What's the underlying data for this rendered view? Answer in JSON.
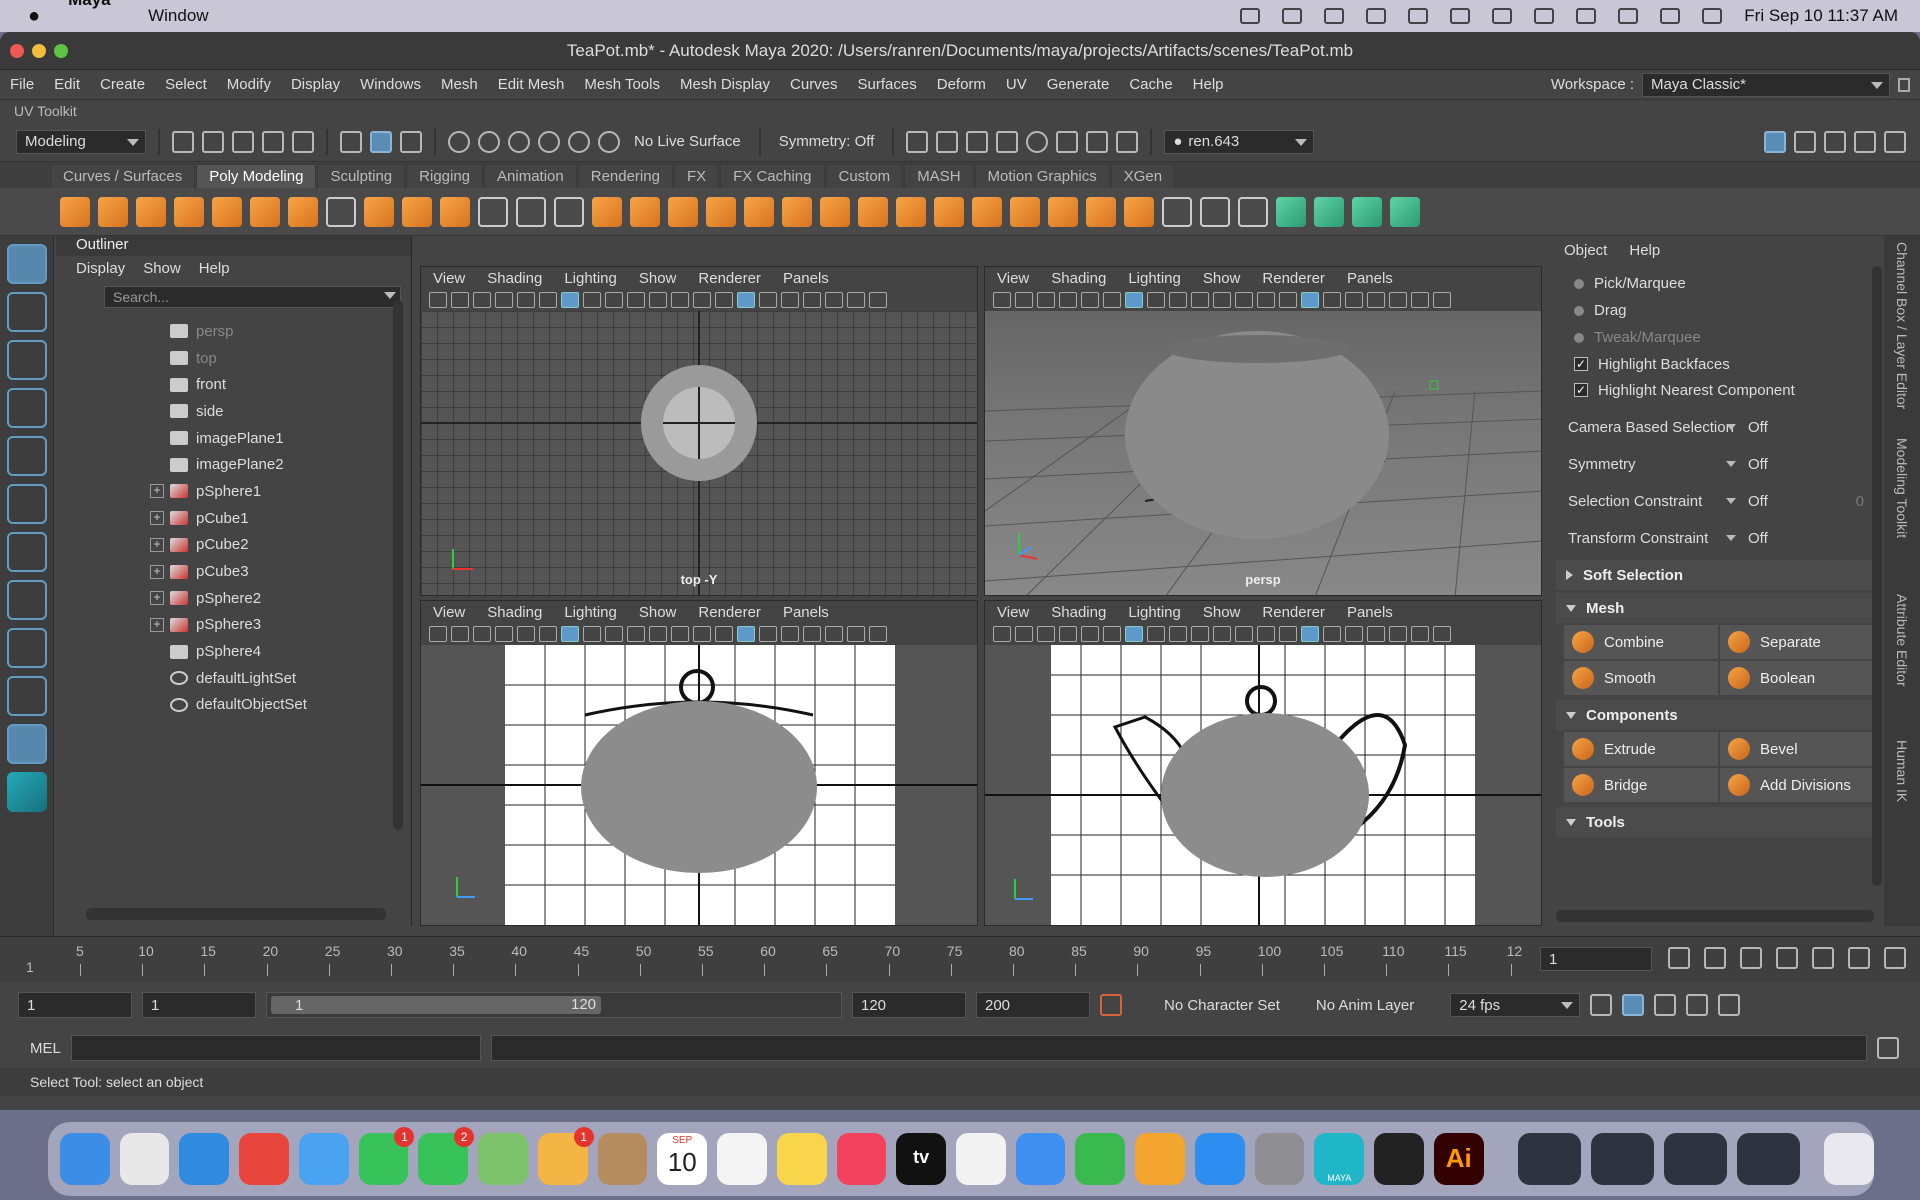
{
  "macos": {
    "app_name": "Maya",
    "menus": [
      "Window"
    ],
    "clock": "Fri Sep 10  11:37 AM"
  },
  "window": {
    "title": "TeaPot.mb* - Autodesk Maya 2020: /Users/ranren/Documents/maya/projects/Artifacts/scenes/TeaPot.mb"
  },
  "menubar": {
    "items": [
      "File",
      "Edit",
      "Create",
      "Select",
      "Modify",
      "Display",
      "Windows",
      "Mesh",
      "Edit Mesh",
      "Mesh Tools",
      "Mesh Display",
      "Curves",
      "Surfaces",
      "Deform",
      "UV",
      "Generate",
      "Cache",
      "Help"
    ],
    "workspace_label": "Workspace :",
    "workspace_value": "Maya Classic*"
  },
  "uv_toolkit": "UV Toolkit",
  "statusline": {
    "mode": "Modeling",
    "live_surface": "No Live Surface",
    "symmetry": "Symmetry: Off",
    "user": "ren.643"
  },
  "shelf": {
    "tabs": [
      "Curves / Surfaces",
      "Poly Modeling",
      "Sculpting",
      "Rigging",
      "Animation",
      "Rendering",
      "FX",
      "FX Caching",
      "Custom",
      "MASH",
      "Motion Graphics",
      "XGen"
    ],
    "active_tab": "Poly Modeling"
  },
  "outliner": {
    "title": "Outliner",
    "menus": [
      "Display",
      "Show",
      "Help"
    ],
    "search_placeholder": "Search...",
    "items": [
      {
        "name": "persp",
        "kind": "camera",
        "dim": true,
        "expand": false
      },
      {
        "name": "top",
        "kind": "camera",
        "dim": true,
        "expand": false
      },
      {
        "name": "front",
        "kind": "camera",
        "dim": false,
        "expand": false
      },
      {
        "name": "side",
        "kind": "camera",
        "dim": false,
        "expand": false
      },
      {
        "name": "imagePlane1",
        "kind": "image",
        "dim": false,
        "expand": false
      },
      {
        "name": "imagePlane2",
        "kind": "image",
        "dim": false,
        "expand": false
      },
      {
        "name": "pSphere1",
        "kind": "mesh",
        "dim": false,
        "expand": true
      },
      {
        "name": "pCube1",
        "kind": "mesh",
        "dim": false,
        "expand": true
      },
      {
        "name": "pCube2",
        "kind": "mesh",
        "dim": false,
        "expand": true
      },
      {
        "name": "pCube3",
        "kind": "mesh",
        "dim": false,
        "expand": true
      },
      {
        "name": "pSphere2",
        "kind": "mesh",
        "dim": false,
        "expand": true
      },
      {
        "name": "pSphere3",
        "kind": "mesh",
        "dim": false,
        "expand": true
      },
      {
        "name": "pSphere4",
        "kind": "group",
        "dim": false,
        "expand": false
      },
      {
        "name": "defaultLightSet",
        "kind": "set",
        "dim": false,
        "expand": false
      },
      {
        "name": "defaultObjectSet",
        "kind": "set",
        "dim": false,
        "expand": false
      }
    ]
  },
  "viewports": {
    "menus": [
      "View",
      "Shading",
      "Lighting",
      "Show",
      "Renderer",
      "Panels"
    ],
    "top_label": "top -Y",
    "persp_label": "persp"
  },
  "toolkit": {
    "menus": [
      "Object",
      "Help"
    ],
    "radios": [
      {
        "label": "Pick/Marquee",
        "dim": false
      },
      {
        "label": "Drag",
        "dim": false
      },
      {
        "label": "Tweak/Marquee",
        "dim": true
      }
    ],
    "checks": [
      "Highlight Backfaces",
      "Highlight Nearest Component"
    ],
    "options": [
      {
        "label": "Camera Based Selection",
        "value": "Off"
      },
      {
        "label": "Symmetry",
        "value": "Off"
      },
      {
        "label": "Selection Constraint",
        "value": "Off",
        "extra": "0"
      },
      {
        "label": "Transform Constraint",
        "value": "Off"
      }
    ],
    "soft_selection": "Soft Selection",
    "mesh_section": "Mesh",
    "mesh_buttons": [
      "Combine",
      "Separate",
      "Smooth",
      "Boolean"
    ],
    "components_section": "Components",
    "components_buttons": [
      "Extrude",
      "Bevel",
      "Bridge",
      "Add Divisions"
    ],
    "tools_section": "Tools"
  },
  "side_tabs": [
    "Channel Box / Layer Editor",
    "Modeling Toolkit",
    "Attribute Editor",
    "Human IK"
  ],
  "timeline": {
    "ticks": [
      "5",
      "10",
      "15",
      "20",
      "25",
      "30",
      "35",
      "40",
      "45",
      "50",
      "55",
      "60",
      "65",
      "70",
      "75",
      "80",
      "85",
      "90",
      "95",
      "100",
      "105",
      "110",
      "115",
      "12"
    ],
    "start_label": "1",
    "current_frame": "1"
  },
  "range": {
    "start": "1",
    "playback_start": "1",
    "slider_start": "1",
    "slider_end": "120",
    "end": "120",
    "anim_end": "200",
    "character_set": "No Character Set",
    "anim_layer": "No Anim Layer",
    "fps": "24 fps"
  },
  "mel": {
    "label": "MEL"
  },
  "help_line": "Select Tool: select an object",
  "dock": {
    "apps": [
      {
        "name": "finder",
        "color": "#3b8de5",
        "badge": ""
      },
      {
        "name": "launchpad",
        "color": "#e8e8e8",
        "badge": ""
      },
      {
        "name": "safari",
        "color": "#2f8ae0",
        "badge": ""
      },
      {
        "name": "chrome",
        "color": "#e8453c",
        "badge": ""
      },
      {
        "name": "mail",
        "color": "#4aa3f0",
        "badge": ""
      },
      {
        "name": "facetime",
        "color": "#37c25a",
        "badge": "1"
      },
      {
        "name": "messages",
        "color": "#37c25a",
        "badge": "2"
      },
      {
        "name": "maps",
        "color": "#7cc26b",
        "badge": ""
      },
      {
        "name": "photos",
        "color": "#f3b543",
        "badge": "1"
      },
      {
        "name": "contacts",
        "color": "#b58c5e",
        "badge": ""
      },
      {
        "name": "calendar",
        "color": "#ffffff",
        "badge": ""
      },
      {
        "name": "reminders",
        "color": "#f4f4f4",
        "badge": ""
      },
      {
        "name": "notes",
        "color": "#f8d54a",
        "badge": ""
      },
      {
        "name": "music",
        "color": "#f3425e",
        "badge": ""
      },
      {
        "name": "tv",
        "color": "#111111",
        "badge": ""
      },
      {
        "name": "news",
        "color": "#f2f2f2",
        "badge": ""
      },
      {
        "name": "keynote",
        "color": "#3e8ff0",
        "badge": ""
      },
      {
        "name": "numbers",
        "color": "#39b94e",
        "badge": ""
      },
      {
        "name": "pages",
        "color": "#f3a530",
        "badge": ""
      },
      {
        "name": "app-store",
        "color": "#2d8ef0",
        "badge": ""
      },
      {
        "name": "system-preferences",
        "color": "#8e8e93",
        "badge": ""
      },
      {
        "name": "maya",
        "color": "#1fb6c8",
        "badge": ""
      },
      {
        "name": "unity",
        "color": "#222222",
        "badge": ""
      },
      {
        "name": "illustrator",
        "color": "#330000",
        "badge": ""
      }
    ],
    "calendar_month": "SEP",
    "calendar_day": "10",
    "tv_label": "tv",
    "illustrator_label": "Ai",
    "maya_label": "MAYA"
  }
}
